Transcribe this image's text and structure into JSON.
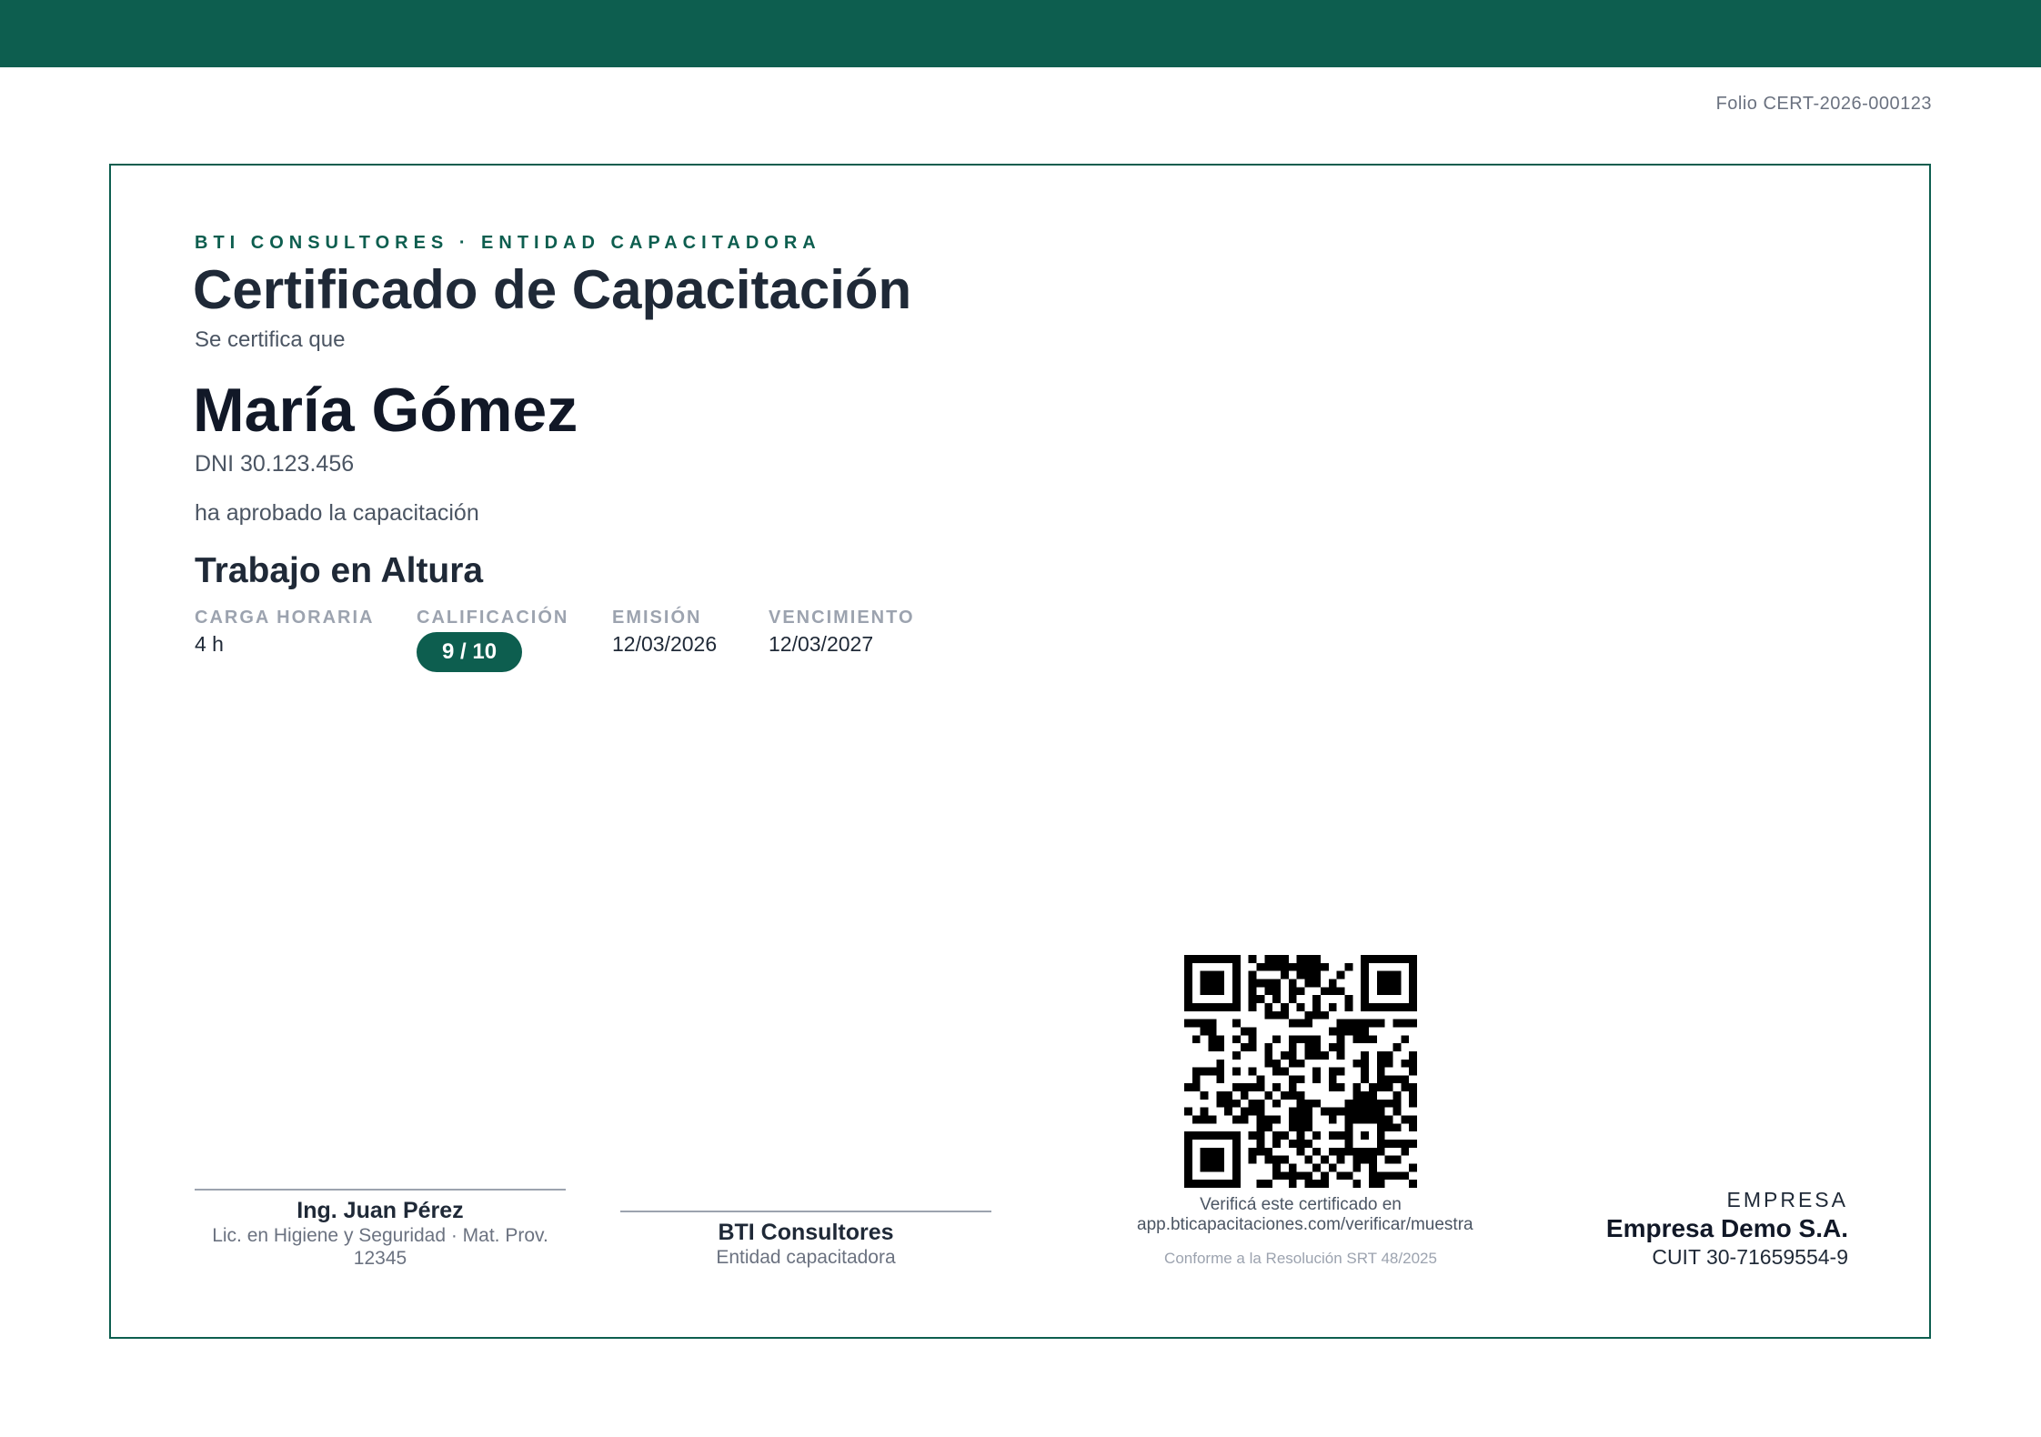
{
  "header": {
    "folio": "Folio CERT-2026-000123"
  },
  "certificate": {
    "entity_line": "BTI CONSULTORES · ENTIDAD CAPACITADORA",
    "title": "Certificado de Capacitación",
    "certifies_text": "Se certifica que",
    "person_name": "María Gómez",
    "dni": "DNI 30.123.456",
    "approved_text": "ha aprobado la capacitación",
    "course_name": "Trabajo en Altura",
    "meta": {
      "hours_label": "CARGA HORARIA",
      "hours_value": "4 h",
      "grade_label": "CALIFICACIÓN",
      "grade_value": "9 / 10",
      "issue_label": "EMISIÓN",
      "issue_value": "12/03/2026",
      "expiry_label": "VENCIMIENTO",
      "expiry_value": "12/03/2027"
    }
  },
  "signatures": {
    "instructor": {
      "name": "Ing. Juan Pérez",
      "role": "Lic. en Higiene y Seguridad · Mat. Prov. 12345"
    },
    "entity": {
      "name": "BTI Consultores",
      "role": "Entidad capacitadora"
    }
  },
  "verification": {
    "text": "Verificá este certificado en",
    "url": "app.bticapacitaciones.com/verificar/muestra",
    "resolution": "Conforme a la Resolución SRT 48/2025"
  },
  "company": {
    "label": "EMPRESA",
    "name": "Empresa Demo S.A.",
    "cuit": "CUIT 30-71659554-9"
  },
  "colors": {
    "brand": "#0d5e4f",
    "text_dark": "#1f2937",
    "text_muted": "#6b7280"
  }
}
